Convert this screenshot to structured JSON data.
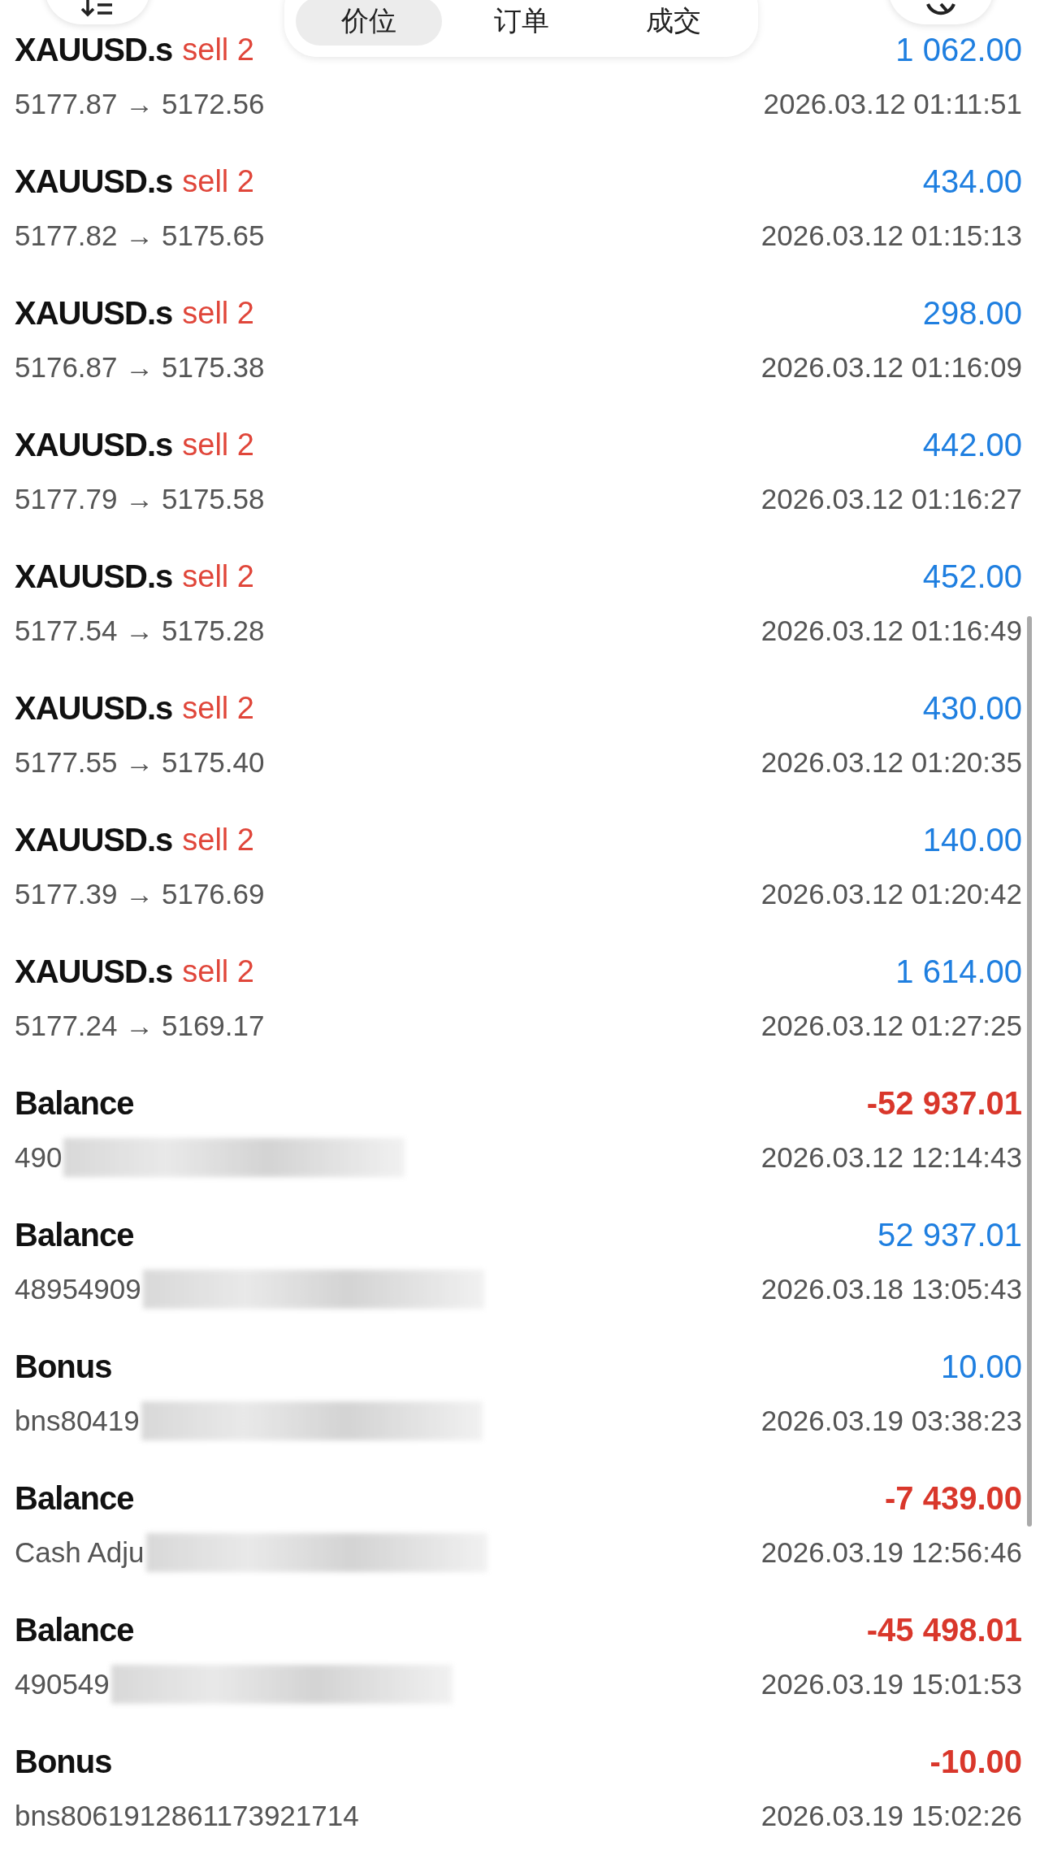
{
  "toolbar": {
    "tabs": [
      {
        "label": "价位",
        "selected": true
      },
      {
        "label": "订单",
        "selected": false
      },
      {
        "label": "成交",
        "selected": false
      }
    ]
  },
  "deals": [
    {
      "kind": "trade",
      "symbol": "XAUUSD.s",
      "side": "sell 2",
      "amount": "1 062.00",
      "positive": true,
      "detail": "5177.87 → 5172.56",
      "time": "2026.03.12 01:11:51"
    },
    {
      "kind": "trade",
      "symbol": "XAUUSD.s",
      "side": "sell 2",
      "amount": "434.00",
      "positive": true,
      "detail": "5177.82 → 5175.65",
      "time": "2026.03.12 01:15:13"
    },
    {
      "kind": "trade",
      "symbol": "XAUUSD.s",
      "side": "sell 2",
      "amount": "298.00",
      "positive": true,
      "detail": "5176.87 → 5175.38",
      "time": "2026.03.12 01:16:09"
    },
    {
      "kind": "trade",
      "symbol": "XAUUSD.s",
      "side": "sell 2",
      "amount": "442.00",
      "positive": true,
      "detail": "5177.79 → 5175.58",
      "time": "2026.03.12 01:16:27"
    },
    {
      "kind": "trade",
      "symbol": "XAUUSD.s",
      "side": "sell 2",
      "amount": "452.00",
      "positive": true,
      "detail": "5177.54 → 5175.28",
      "time": "2026.03.12 01:16:49"
    },
    {
      "kind": "trade",
      "symbol": "XAUUSD.s",
      "side": "sell 2",
      "amount": "430.00",
      "positive": true,
      "detail": "5177.55 → 5175.40",
      "time": "2026.03.12 01:20:35"
    },
    {
      "kind": "trade",
      "symbol": "XAUUSD.s",
      "side": "sell 2",
      "amount": "140.00",
      "positive": true,
      "detail": "5177.39 → 5176.69",
      "time": "2026.03.12 01:20:42"
    },
    {
      "kind": "trade",
      "symbol": "XAUUSD.s",
      "side": "sell 2",
      "amount": "1 614.00",
      "positive": true,
      "detail": "5177.24 → 5169.17",
      "time": "2026.03.12 01:27:25"
    },
    {
      "kind": "balance",
      "symbol": "Balance",
      "amount": "-52 937.01",
      "positive": false,
      "detail": "490",
      "redacted": true,
      "time": "2026.03.12 12:14:43"
    },
    {
      "kind": "balance",
      "symbol": "Balance",
      "amount": "52 937.01",
      "positive": true,
      "detail": "48954909",
      "redacted": true,
      "time": "2026.03.18 13:05:43"
    },
    {
      "kind": "balance",
      "symbol": "Bonus",
      "amount": "10.00",
      "positive": true,
      "detail": "bns80419",
      "redacted": true,
      "time": "2026.03.19 03:38:23"
    },
    {
      "kind": "balance",
      "symbol": "Balance",
      "amount": "-7 439.00",
      "positive": false,
      "detail": "Cash Adju",
      "redacted": true,
      "time": "2026.03.19 12:56:46"
    },
    {
      "kind": "balance",
      "symbol": "Balance",
      "amount": "-45 498.01",
      "positive": false,
      "detail": "490549",
      "redacted": true,
      "time": "2026.03.19 15:01:53"
    },
    {
      "kind": "balance",
      "symbol": "Bonus",
      "amount": "-10.00",
      "positive": false,
      "detail": "bns8061912861173921714",
      "time": "2026.03.19 15:02:26"
    }
  ]
}
